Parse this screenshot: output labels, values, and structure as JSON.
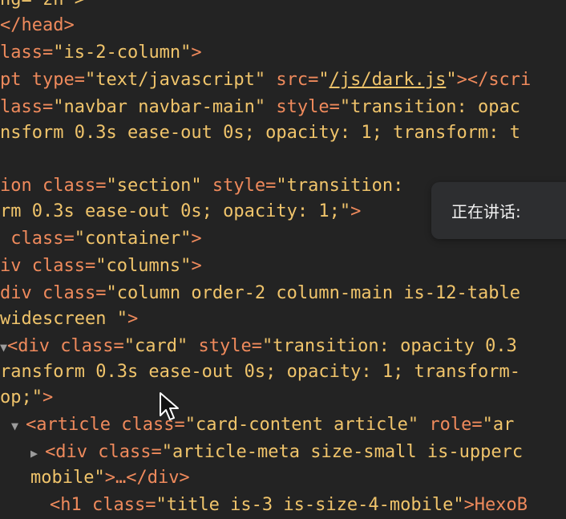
{
  "toast": {
    "text": "正在讲话:"
  },
  "lines": [
    [
      "ng=\"zh\">"
    ],
    [
      "</head>"
    ],
    [
      "lass=",
      "\"is-2-column\"",
      ">"
    ],
    [
      "pt type=",
      "\"text/javascript\"",
      " src=",
      "\"",
      "/js/dark.js",
      "\"",
      "></scri"
    ],
    [
      "lass=",
      "\"navbar navbar-main\"",
      " style=",
      "\"transition: opac"
    ],
    [
      "nsform 0.3s ease-out 0s; opacity: 1; transform: t"
    ],
    [
      "ion class=",
      "\"section\"",
      " style=",
      "\"transition: "
    ],
    [
      "rm 0.3s ease-out 0s; opacity: 1;\"",
      ">"
    ],
    [
      " class=",
      "\"container\"",
      ">"
    ],
    [
      "iv class=",
      "\"columns\"",
      ">"
    ],
    [
      "div class=",
      "\"column order-2 column-main is-12-table"
    ],
    [
      "widescreen \"",
      ">"
    ],
    [
      "<div class=",
      "\"card\"",
      " style=",
      "\"transition: opacity 0.3"
    ],
    [
      "ransform 0.3s ease-out 0s; opacity: 1; transform-"
    ],
    [
      "op;\"",
      ">"
    ],
    [
      "<article class=",
      "\"card-content article\"",
      " role=",
      "\"ar"
    ],
    [
      "<div class=",
      "\"article-meta size-small is-upperc"
    ],
    [
      "mobile\"",
      ">…</div>"
    ],
    [
      "<h1 class=",
      "\"title is-3 is-size-4-mobile\"",
      ">HexoB"
    ]
  ]
}
